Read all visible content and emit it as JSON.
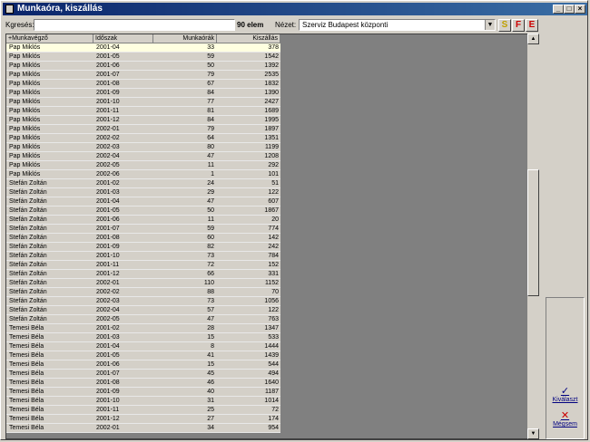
{
  "window": {
    "title": "Munkaóra, kiszállás"
  },
  "toolbar": {
    "search_label": "Kgresés:",
    "search_value": "",
    "count": "90 elem",
    "view_label": "Nézet:",
    "view_value": "Szerviz Budapest központi",
    "btn_s": "S",
    "btn_f": "F",
    "btn_e": "E"
  },
  "table": {
    "headers": [
      "+Munkavégző",
      "Időszak",
      "Munkaórák",
      "Kiszállás"
    ],
    "rows": [
      [
        "Pap Miklós",
        "2001-04",
        "33",
        "378"
      ],
      [
        "Pap Miklós",
        "2001-05",
        "59",
        "1542"
      ],
      [
        "Pap Miklós",
        "2001-06",
        "50",
        "1392"
      ],
      [
        "Pap Miklós",
        "2001-07",
        "79",
        "2535"
      ],
      [
        "Pap Miklós",
        "2001-08",
        "67",
        "1832"
      ],
      [
        "Pap Miklós",
        "2001-09",
        "84",
        "1390"
      ],
      [
        "Pap Miklós",
        "2001-10",
        "77",
        "2427"
      ],
      [
        "Pap Miklós",
        "2001-11",
        "81",
        "1689"
      ],
      [
        "Pap Miklós",
        "2001-12",
        "84",
        "1995"
      ],
      [
        "Pap Miklós",
        "2002-01",
        "79",
        "1897"
      ],
      [
        "Pap Miklós",
        "2002-02",
        "64",
        "1351"
      ],
      [
        "Pap Miklós",
        "2002-03",
        "80",
        "1199"
      ],
      [
        "Pap Miklós",
        "2002-04",
        "47",
        "1208"
      ],
      [
        "Pap Miklós",
        "2002-05",
        "11",
        "292"
      ],
      [
        "Pap Miklós",
        "2002-06",
        "1",
        "101"
      ],
      [
        "Stefán Zoltán",
        "2001-02",
        "24",
        "51"
      ],
      [
        "Stefán Zoltán",
        "2001-03",
        "29",
        "122"
      ],
      [
        "Stefán Zoltán",
        "2001-04",
        "47",
        "607"
      ],
      [
        "Stefán Zoltán",
        "2001-05",
        "50",
        "1867"
      ],
      [
        "Stefán Zoltán",
        "2001-06",
        "11",
        "20"
      ],
      [
        "Stefán Zoltán",
        "2001-07",
        "59",
        "774"
      ],
      [
        "Stefán Zoltán",
        "2001-08",
        "60",
        "142"
      ],
      [
        "Stefán Zoltán",
        "2001-09",
        "82",
        "242"
      ],
      [
        "Stefán Zoltán",
        "2001-10",
        "73",
        "784"
      ],
      [
        "Stefán Zoltán",
        "2001-11",
        "72",
        "152"
      ],
      [
        "Stefán Zoltán",
        "2001-12",
        "66",
        "331"
      ],
      [
        "Stefán Zoltán",
        "2002-01",
        "110",
        "1152"
      ],
      [
        "Stefán Zoltán",
        "2002-02",
        "88",
        "70"
      ],
      [
        "Stefán Zoltán",
        "2002-03",
        "73",
        "1056"
      ],
      [
        "Stefán Zoltán",
        "2002-04",
        "57",
        "122"
      ],
      [
        "Stefán Zoltán",
        "2002-05",
        "47",
        "763"
      ],
      [
        "Temesi Béla",
        "2001-02",
        "28",
        "1347"
      ],
      [
        "Temesi Béla",
        "2001-03",
        "15",
        "533"
      ],
      [
        "Temesi Béla",
        "2001-04",
        "8",
        "1444"
      ],
      [
        "Temesi Béla",
        "2001-05",
        "41",
        "1439"
      ],
      [
        "Temesi Béla",
        "2001-06",
        "15",
        "544"
      ],
      [
        "Temesi Béla",
        "2001-07",
        "45",
        "494"
      ],
      [
        "Temesi Béla",
        "2001-08",
        "46",
        "1640"
      ],
      [
        "Temesi Béla",
        "2001-09",
        "40",
        "1187"
      ],
      [
        "Temesi Béla",
        "2001-10",
        "31",
        "1014"
      ],
      [
        "Temesi Béla",
        "2001-11",
        "25",
        "72"
      ],
      [
        "Temesi Béla",
        "2001-12",
        "27",
        "174"
      ],
      [
        "Temesi Béla",
        "2002-01",
        "34",
        "954"
      ]
    ]
  },
  "actions": {
    "select_label": "Kiválaszt",
    "cancel_label": "Mégsem"
  },
  "colors": {
    "title_bar": "#0a246a",
    "selected_row": "#ffffe0",
    "btn_f": "#cc0000",
    "btn_e": "#cc0000",
    "btn_s": "#c0a000",
    "cancel_icon": "#cc0000",
    "select_icon": "#000080"
  }
}
